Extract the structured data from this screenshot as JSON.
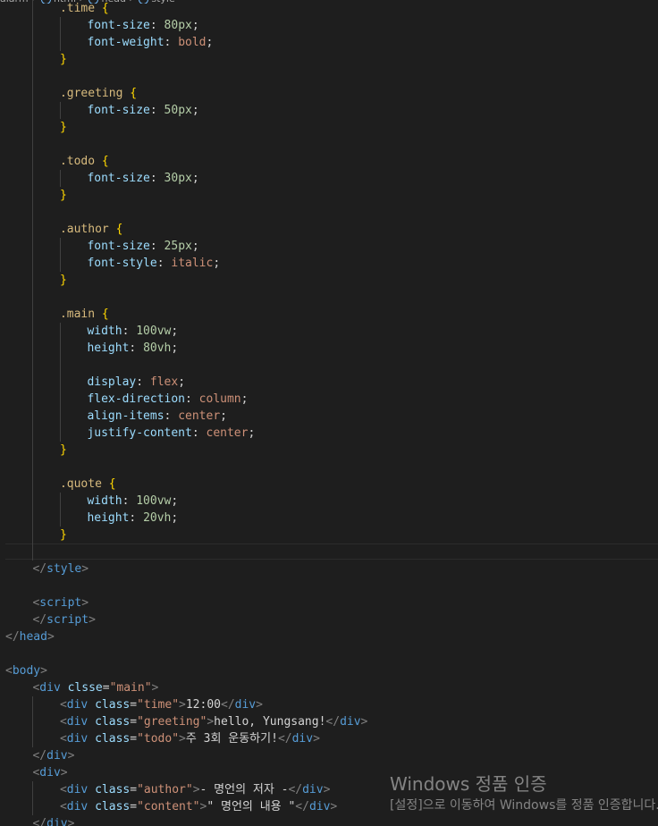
{
  "breadcrumb": {
    "items": [
      "alarm",
      "html",
      "head",
      "style"
    ]
  },
  "colors": {
    "background": "#1e1e1e",
    "selector": "#d7ba7d",
    "property": "#9cdcfe",
    "number": "#b5cea8",
    "keyword_value": "#ce9178",
    "brace": "#ffd700",
    "tag": "#569cd6",
    "tag_bracket": "#808080",
    "string": "#ce9178",
    "text": "#d4d4d4"
  },
  "code_lines": [
    {
      "indent": 8,
      "guides": [
        4
      ],
      "tokens": [
        [
          "sel",
          ".time"
        ],
        [
          "punc",
          " "
        ],
        [
          "brace",
          "{"
        ]
      ]
    },
    {
      "indent": 12,
      "guides": [
        4,
        8
      ],
      "tokens": [
        [
          "prop",
          "font-size"
        ],
        [
          "punc",
          ": "
        ],
        [
          "num",
          "80px"
        ],
        [
          "punc",
          ";"
        ]
      ]
    },
    {
      "indent": 12,
      "guides": [
        4,
        8
      ],
      "tokens": [
        [
          "prop",
          "font-weight"
        ],
        [
          "punc",
          ": "
        ],
        [
          "kw",
          "bold"
        ],
        [
          "punc",
          ";"
        ]
      ]
    },
    {
      "indent": 8,
      "guides": [
        4
      ],
      "tokens": [
        [
          "brace",
          "}"
        ]
      ]
    },
    {
      "indent": 0,
      "guides": [
        4
      ],
      "tokens": []
    },
    {
      "indent": 8,
      "guides": [
        4
      ],
      "tokens": [
        [
          "sel",
          ".greeting"
        ],
        [
          "punc",
          " "
        ],
        [
          "brace",
          "{"
        ]
      ]
    },
    {
      "indent": 12,
      "guides": [
        4,
        8
      ],
      "tokens": [
        [
          "prop",
          "font-size"
        ],
        [
          "punc",
          ": "
        ],
        [
          "num",
          "50px"
        ],
        [
          "punc",
          ";"
        ]
      ]
    },
    {
      "indent": 8,
      "guides": [
        4
      ],
      "tokens": [
        [
          "brace",
          "}"
        ]
      ]
    },
    {
      "indent": 0,
      "guides": [
        4
      ],
      "tokens": []
    },
    {
      "indent": 8,
      "guides": [
        4
      ],
      "tokens": [
        [
          "sel",
          ".todo"
        ],
        [
          "punc",
          " "
        ],
        [
          "brace",
          "{"
        ]
      ]
    },
    {
      "indent": 12,
      "guides": [
        4,
        8
      ],
      "tokens": [
        [
          "prop",
          "font-size"
        ],
        [
          "punc",
          ": "
        ],
        [
          "num",
          "30px"
        ],
        [
          "punc",
          ";"
        ]
      ]
    },
    {
      "indent": 8,
      "guides": [
        4
      ],
      "tokens": [
        [
          "brace",
          "}"
        ]
      ]
    },
    {
      "indent": 0,
      "guides": [
        4
      ],
      "tokens": []
    },
    {
      "indent": 8,
      "guides": [
        4
      ],
      "tokens": [
        [
          "sel",
          ".author"
        ],
        [
          "punc",
          " "
        ],
        [
          "brace",
          "{"
        ]
      ]
    },
    {
      "indent": 12,
      "guides": [
        4,
        8
      ],
      "tokens": [
        [
          "prop",
          "font-size"
        ],
        [
          "punc",
          ": "
        ],
        [
          "num",
          "25px"
        ],
        [
          "punc",
          ";"
        ]
      ]
    },
    {
      "indent": 12,
      "guides": [
        4,
        8
      ],
      "tokens": [
        [
          "prop",
          "font-style"
        ],
        [
          "punc",
          ": "
        ],
        [
          "kw",
          "italic"
        ],
        [
          "punc",
          ";"
        ]
      ]
    },
    {
      "indent": 8,
      "guides": [
        4
      ],
      "tokens": [
        [
          "brace",
          "}"
        ]
      ]
    },
    {
      "indent": 0,
      "guides": [
        4
      ],
      "tokens": []
    },
    {
      "indent": 8,
      "guides": [
        4
      ],
      "tokens": [
        [
          "sel",
          ".main"
        ],
        [
          "punc",
          " "
        ],
        [
          "brace",
          "{"
        ]
      ]
    },
    {
      "indent": 12,
      "guides": [
        4,
        8
      ],
      "tokens": [
        [
          "prop",
          "width"
        ],
        [
          "punc",
          ": "
        ],
        [
          "num",
          "100vw"
        ],
        [
          "punc",
          ";"
        ]
      ]
    },
    {
      "indent": 12,
      "guides": [
        4,
        8
      ],
      "tokens": [
        [
          "prop",
          "height"
        ],
        [
          "punc",
          ": "
        ],
        [
          "num",
          "80vh"
        ],
        [
          "punc",
          ";"
        ]
      ]
    },
    {
      "indent": 0,
      "guides": [
        4,
        8
      ],
      "tokens": []
    },
    {
      "indent": 12,
      "guides": [
        4,
        8
      ],
      "tokens": [
        [
          "prop",
          "display"
        ],
        [
          "punc",
          ": "
        ],
        [
          "kw",
          "flex"
        ],
        [
          "punc",
          ";"
        ]
      ]
    },
    {
      "indent": 12,
      "guides": [
        4,
        8
      ],
      "tokens": [
        [
          "prop",
          "flex-direction"
        ],
        [
          "punc",
          ": "
        ],
        [
          "kw",
          "column"
        ],
        [
          "punc",
          ";"
        ]
      ]
    },
    {
      "indent": 12,
      "guides": [
        4,
        8
      ],
      "tokens": [
        [
          "prop",
          "align-items"
        ],
        [
          "punc",
          ": "
        ],
        [
          "kw",
          "center"
        ],
        [
          "punc",
          ";"
        ]
      ]
    },
    {
      "indent": 12,
      "guides": [
        4,
        8
      ],
      "tokens": [
        [
          "prop",
          "justify-content"
        ],
        [
          "punc",
          ": "
        ],
        [
          "kw",
          "center"
        ],
        [
          "punc",
          ";"
        ]
      ]
    },
    {
      "indent": 8,
      "guides": [
        4
      ],
      "tokens": [
        [
          "brace",
          "}"
        ]
      ]
    },
    {
      "indent": 0,
      "guides": [
        4
      ],
      "tokens": []
    },
    {
      "indent": 8,
      "guides": [
        4
      ],
      "tokens": [
        [
          "sel",
          ".quote"
        ],
        [
          "punc",
          " "
        ],
        [
          "brace",
          "{"
        ]
      ]
    },
    {
      "indent": 12,
      "guides": [
        4,
        8
      ],
      "tokens": [
        [
          "prop",
          "width"
        ],
        [
          "punc",
          ": "
        ],
        [
          "num",
          "100vw"
        ],
        [
          "punc",
          ";"
        ]
      ]
    },
    {
      "indent": 12,
      "guides": [
        4,
        8
      ],
      "tokens": [
        [
          "prop",
          "height"
        ],
        [
          "punc",
          ": "
        ],
        [
          "num",
          "20vh"
        ],
        [
          "punc",
          ";"
        ]
      ]
    },
    {
      "indent": 8,
      "guides": [
        4
      ],
      "tokens": [
        [
          "brace",
          "}"
        ]
      ]
    },
    {
      "indent": 0,
      "guides": [
        4
      ],
      "tokens": []
    },
    {
      "indent": 4,
      "guides": [],
      "tokens": [
        [
          "tag-bracket",
          "</"
        ],
        [
          "tag",
          "style"
        ],
        [
          "tag-bracket",
          ">"
        ]
      ]
    },
    {
      "indent": 0,
      "guides": [],
      "tokens": []
    },
    {
      "indent": 4,
      "guides": [],
      "tokens": [
        [
          "tag-bracket",
          "<"
        ],
        [
          "tag",
          "script"
        ],
        [
          "tag-bracket",
          ">"
        ]
      ]
    },
    {
      "indent": 4,
      "guides": [],
      "tokens": [
        [
          "tag-bracket",
          "</"
        ],
        [
          "tag",
          "script"
        ],
        [
          "tag-bracket",
          ">"
        ]
      ]
    },
    {
      "indent": 0,
      "guides": [],
      "tokens": [
        [
          "tag-bracket",
          "</"
        ],
        [
          "tag",
          "head"
        ],
        [
          "tag-bracket",
          ">"
        ]
      ]
    },
    {
      "indent": 0,
      "guides": [],
      "tokens": []
    },
    {
      "indent": 0,
      "guides": [],
      "tokens": [
        [
          "tag-bracket",
          "<"
        ],
        [
          "tag",
          "body"
        ],
        [
          "tag-bracket",
          ">"
        ]
      ]
    },
    {
      "indent": 4,
      "guides": [],
      "tokens": [
        [
          "tag-bracket",
          "<"
        ],
        [
          "tag",
          "div"
        ],
        [
          "punc",
          " "
        ],
        [
          "attr",
          "clsse"
        ],
        [
          "punc",
          "="
        ],
        [
          "str",
          "\"main\""
        ],
        [
          "tag-bracket",
          ">"
        ]
      ]
    },
    {
      "indent": 8,
      "guides": [
        4
      ],
      "tokens": [
        [
          "tag-bracket",
          "<"
        ],
        [
          "tag",
          "div"
        ],
        [
          "punc",
          " "
        ],
        [
          "attr",
          "class"
        ],
        [
          "punc",
          "="
        ],
        [
          "str",
          "\"time\""
        ],
        [
          "tag-bracket",
          ">"
        ],
        [
          "text",
          "12:00"
        ],
        [
          "tag-bracket",
          "</"
        ],
        [
          "tag",
          "div"
        ],
        [
          "tag-bracket",
          ">"
        ]
      ]
    },
    {
      "indent": 8,
      "guides": [
        4
      ],
      "tokens": [
        [
          "tag-bracket",
          "<"
        ],
        [
          "tag",
          "div"
        ],
        [
          "punc",
          " "
        ],
        [
          "attr",
          "class"
        ],
        [
          "punc",
          "="
        ],
        [
          "str",
          "\"greeting\""
        ],
        [
          "tag-bracket",
          ">"
        ],
        [
          "text",
          "hello, Yungsang!"
        ],
        [
          "tag-bracket",
          "</"
        ],
        [
          "tag",
          "div"
        ],
        [
          "tag-bracket",
          ">"
        ]
      ]
    },
    {
      "indent": 8,
      "guides": [
        4
      ],
      "tokens": [
        [
          "tag-bracket",
          "<"
        ],
        [
          "tag",
          "div"
        ],
        [
          "punc",
          " "
        ],
        [
          "attr",
          "class"
        ],
        [
          "punc",
          "="
        ],
        [
          "str",
          "\"todo\""
        ],
        [
          "tag-bracket",
          ">"
        ],
        [
          "text",
          "주 3회 운동하기!"
        ],
        [
          "tag-bracket",
          "</"
        ],
        [
          "tag",
          "div"
        ],
        [
          "tag-bracket",
          ">"
        ]
      ]
    },
    {
      "indent": 4,
      "guides": [],
      "tokens": [
        [
          "tag-bracket",
          "</"
        ],
        [
          "tag",
          "div"
        ],
        [
          "tag-bracket",
          ">"
        ]
      ]
    },
    {
      "indent": 4,
      "guides": [],
      "tokens": [
        [
          "tag-bracket",
          "<"
        ],
        [
          "tag",
          "div"
        ],
        [
          "tag-bracket",
          ">"
        ]
      ]
    },
    {
      "indent": 8,
      "guides": [
        4
      ],
      "tokens": [
        [
          "tag-bracket",
          "<"
        ],
        [
          "tag",
          "div"
        ],
        [
          "punc",
          " "
        ],
        [
          "attr",
          "class"
        ],
        [
          "punc",
          "="
        ],
        [
          "str",
          "\"author\""
        ],
        [
          "tag-bracket",
          ">"
        ],
        [
          "text",
          "- 명언의 저자 -"
        ],
        [
          "tag-bracket",
          "</"
        ],
        [
          "tag",
          "div"
        ],
        [
          "tag-bracket",
          ">"
        ]
      ]
    },
    {
      "indent": 8,
      "guides": [
        4
      ],
      "tokens": [
        [
          "tag-bracket",
          "<"
        ],
        [
          "tag",
          "div"
        ],
        [
          "punc",
          " "
        ],
        [
          "attr",
          "class"
        ],
        [
          "punc",
          "="
        ],
        [
          "str",
          "\"content\""
        ],
        [
          "tag-bracket",
          ">"
        ],
        [
          "text",
          "\" 명언의 내용 \""
        ],
        [
          "tag-bracket",
          "</"
        ],
        [
          "tag",
          "div"
        ],
        [
          "tag-bracket",
          ">"
        ]
      ]
    },
    {
      "indent": 4,
      "guides": [],
      "tokens": [
        [
          "tag-bracket",
          "</"
        ],
        [
          "tag",
          "div"
        ],
        [
          "tag-bracket",
          ">"
        ]
      ]
    }
  ],
  "watermark": {
    "title": "Windows 정품 인증",
    "subtitle": "[설정]으로 이동하여 Windows를 정품 인증합니다."
  }
}
